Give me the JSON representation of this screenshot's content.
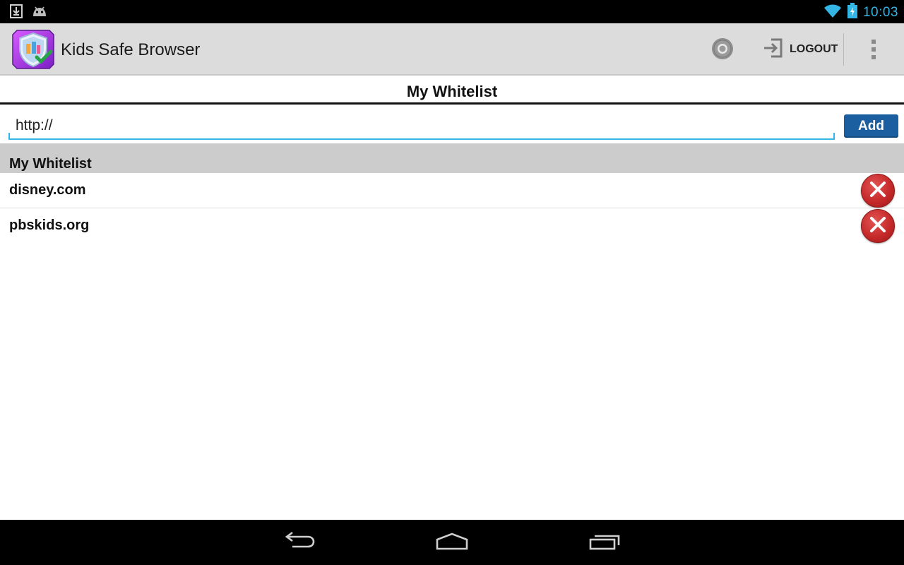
{
  "status_bar": {
    "time": "10:03",
    "icons": [
      "download-notification-icon",
      "android-debug-icon",
      "wifi-icon",
      "battery-charging-icon"
    ]
  },
  "action_bar": {
    "app_title": "Kids Safe Browser",
    "logo_icon": "kids-shield-logo",
    "settings_icon": "gear-icon",
    "logout_label": "LOGOUT",
    "logout_icon": "logout-icon",
    "overflow_icon": "overflow-menu-icon"
  },
  "page": {
    "title": "My Whitelist"
  },
  "url_form": {
    "value": "http://",
    "add_label": "Add"
  },
  "whitelist": {
    "header": "My Whitelist",
    "items": [
      {
        "label": "disney.com"
      },
      {
        "label": "pbskids.org"
      }
    ]
  },
  "nav_bar": {
    "icons": [
      "back-icon",
      "home-icon",
      "recent-apps-icon"
    ]
  },
  "colors": {
    "accent": "#33b5e5",
    "action_bar": "#dcdcdc",
    "add_button": "#1c5fa0",
    "remove_button": "#c62a2a",
    "list_header": "#cccccc"
  }
}
